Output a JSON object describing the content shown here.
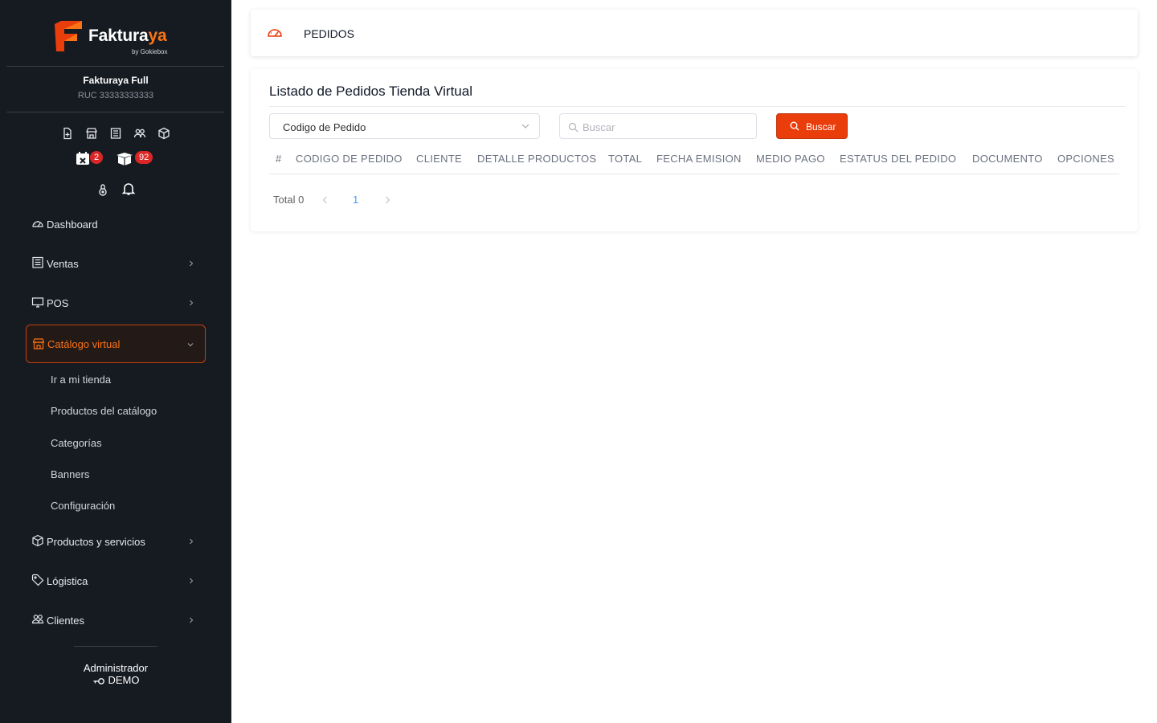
{
  "sidebar": {
    "brand": {
      "name_main": "Faktura",
      "name_accent": "ya",
      "sub": "by Gokiebox"
    },
    "company": {
      "name": "Fakturaya Full",
      "ruc": "RUC 33333333333"
    },
    "quick_icons": [
      "file-plus-icon",
      "store-icon",
      "receipt-icon",
      "users-icon",
      "box-icon"
    ],
    "badges": [
      {
        "icon": "calendar-x-icon",
        "count": "2"
      },
      {
        "icon": "open-box-icon",
        "count": "92"
      }
    ],
    "alerts": [
      "lock-icon",
      "bell-icon"
    ],
    "nav": [
      {
        "label": "Dashboard",
        "icon": "gauge-icon",
        "has_children": false
      },
      {
        "label": "Ventas",
        "icon": "receipt-icon",
        "has_children": true
      },
      {
        "label": "POS",
        "icon": "monitor-icon",
        "has_children": true
      },
      {
        "label": "Catálogo virtual",
        "icon": "store-icon",
        "has_children": true,
        "active": true,
        "expanded": true
      },
      {
        "label": "Productos y servicios",
        "icon": "box-icon",
        "has_children": true
      },
      {
        "label": "Lógistica",
        "icon": "tag-icon",
        "has_children": true
      },
      {
        "label": "Clientes",
        "icon": "users-icon",
        "has_children": true
      }
    ],
    "catalog_sub": [
      "Ir a mi tienda",
      "Productos del catálogo",
      "Categorías",
      "Banners",
      "Configuración"
    ],
    "footer": {
      "role": "Administrador",
      "user": "DEMO"
    }
  },
  "topbar": {
    "title": "PEDIDOS",
    "icon": "gauge-icon"
  },
  "main": {
    "title": "Listado de Pedidos Tienda Virtual",
    "filter": {
      "selected": "Codigo de Pedido"
    },
    "search": {
      "placeholder": "Buscar",
      "value": ""
    },
    "search_button": "Buscar",
    "columns": [
      "#",
      "CODIGO DE PEDIDO",
      "CLIENTE",
      "DETALLE PRODUCTOS",
      "TOTAL",
      "FECHA EMISION",
      "MEDIO PAGO",
      "ESTATUS DEL PEDIDO",
      "DOCUMENTO",
      "OPCIONES"
    ],
    "rows": [],
    "pagination": {
      "total_label": "Total 0",
      "current_page": "1"
    }
  },
  "colors": {
    "sidebar_bg": "#161b22",
    "accent": "#ea3d0c",
    "active_text": "#f97316",
    "badge": "#dc2626",
    "page_link": "#409eff"
  }
}
